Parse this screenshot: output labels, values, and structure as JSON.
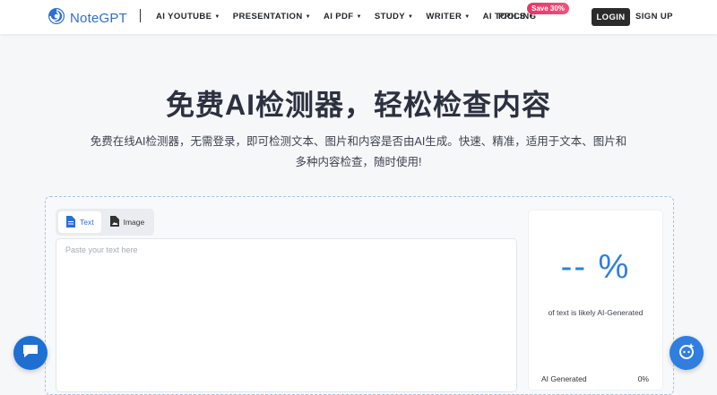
{
  "header": {
    "logo_text": "NoteGPT",
    "nav": [
      {
        "label": "AI YOUTUBE"
      },
      {
        "label": "PRESENTATION"
      },
      {
        "label": "AI PDF"
      },
      {
        "label": "STUDY"
      },
      {
        "label": "WRITER"
      },
      {
        "label": "AI TOOLS"
      }
    ],
    "pricing": "PRICING",
    "save_badge": "Save 30%",
    "login": "LOGIN",
    "signup": "SIGN UP"
  },
  "hero": {
    "title": "免费AI检测器，轻松检查内容",
    "subtitle": "免费在线AI检测器，无需登录，即可检测文本、图片和内容是否由AI生成。快速、精准，适用于文本、图片和多种内容检查，随时使用!"
  },
  "tabs": {
    "text": "Text",
    "image": "Image"
  },
  "input": {
    "placeholder": "Paste your text here"
  },
  "result": {
    "percent": "-- %",
    "caption": "of text is likely AI-Generated",
    "ai_generated_label": "AI Generated",
    "ai_generated_value": "0%"
  },
  "colors": {
    "accent": "#2f7ee0",
    "badge": "#e8346a",
    "login_bg": "#2b2b2b"
  }
}
